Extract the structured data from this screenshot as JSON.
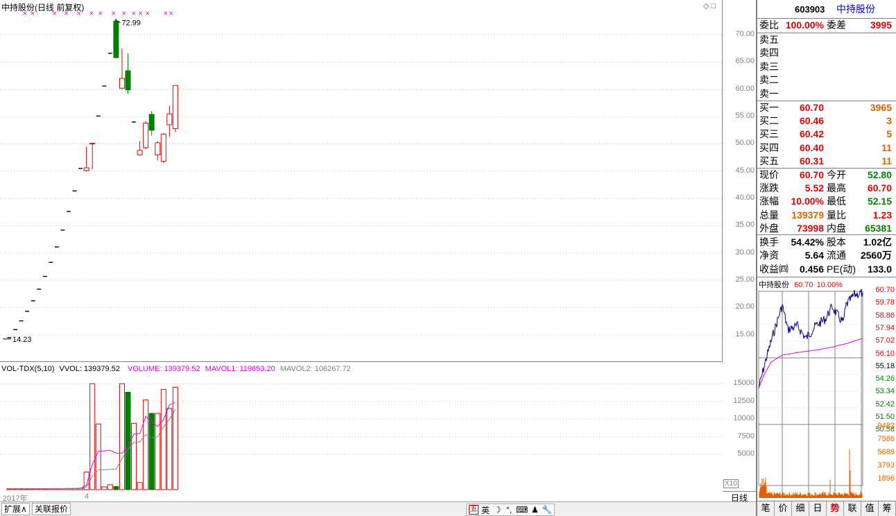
{
  "main": {
    "title": "中持股份(日线 前复权)",
    "max_label": "72.99",
    "min_label": "14.23",
    "price_ticks": [
      "70.00",
      "65.00",
      "60.00",
      "55.00",
      "50.00",
      "45.00",
      "40.00",
      "35.00",
      "30.00",
      "25.00",
      "20.00",
      "15.00"
    ],
    "candles": [
      {
        "o": 14.5,
        "h": 14.5,
        "l": 14.5,
        "c": 14.5
      },
      {
        "o": 15.95,
        "h": 15.95,
        "l": 15.95,
        "c": 15.95
      },
      {
        "o": 17.55,
        "h": 17.55,
        "l": 17.55,
        "c": 17.55
      },
      {
        "o": 19.31,
        "h": 19.31,
        "l": 19.31,
        "c": 19.31
      },
      {
        "o": 21.24,
        "h": 21.24,
        "l": 21.24,
        "c": 21.24
      },
      {
        "o": 23.36,
        "h": 23.36,
        "l": 23.36,
        "c": 23.36
      },
      {
        "o": 25.7,
        "h": 25.7,
        "l": 25.7,
        "c": 25.7
      },
      {
        "o": 28.27,
        "h": 28.27,
        "l": 28.27,
        "c": 28.27
      },
      {
        "o": 31.1,
        "h": 31.1,
        "l": 31.1,
        "c": 31.1
      },
      {
        "o": 34.2,
        "h": 34.2,
        "l": 34.2,
        "c": 34.2
      },
      {
        "o": 37.62,
        "h": 37.62,
        "l": 37.62,
        "c": 37.62
      },
      {
        "o": 41.38,
        "h": 41.38,
        "l": 41.38,
        "c": 41.38
      },
      {
        "o": 45.5,
        "h": 45.5,
        "l": 45.5,
        "c": 45.5
      },
      {
        "o": 45.1,
        "h": 49.5,
        "l": 44.9,
        "c": 45.6
      },
      {
        "o": 50.1,
        "h": 50.1,
        "l": 45.3,
        "c": 50.1
      },
      {
        "o": 55.1,
        "h": 55.1,
        "l": 55.1,
        "c": 55.1
      },
      {
        "o": 60.6,
        "h": 60.6,
        "l": 60.6,
        "c": 60.6
      },
      {
        "o": 66.6,
        "h": 66.6,
        "l": 66.6,
        "c": 66.6
      },
      {
        "o": 72.5,
        "h": 72.99,
        "l": 65.8,
        "c": 65.8
      },
      {
        "o": 60.2,
        "h": 67.5,
        "l": 60.0,
        "c": 62.0
      },
      {
        "o": 63.4,
        "h": 66.6,
        "l": 59.2,
        "c": 59.9
      },
      {
        "o": 54.0,
        "h": 54.0,
        "l": 54.0,
        "c": 54.0
      },
      {
        "o": 48.0,
        "h": 50.5,
        "l": 47.8,
        "c": 48.8
      },
      {
        "o": 49.3,
        "h": 54.2,
        "l": 49.0,
        "c": 53.8
      },
      {
        "o": 55.4,
        "h": 56.0,
        "l": 51.5,
        "c": 52.5
      },
      {
        "o": 48.0,
        "h": 50.5,
        "l": 47.0,
        "c": 50.2
      },
      {
        "o": 46.8,
        "h": 52.0,
        "l": 46.5,
        "c": 51.8
      },
      {
        "o": 53.5,
        "h": 57.0,
        "l": 51.3,
        "c": 55.5
      },
      {
        "o": 52.8,
        "h": 60.7,
        "l": 52.15,
        "c": 60.7
      }
    ],
    "ma_marks_count": 12
  },
  "volume": {
    "label": "VOL-TDX(5,10)",
    "vvol": "VVOL: 139379.52",
    "volume": "VOLUME: 139379.52",
    "mavol1": "MAVOL1: 119653.20",
    "mavol2": "MAVOL2: 106267.72",
    "ticks": [
      "15000",
      "12500",
      "10000",
      "7500",
      "5000"
    ],
    "x10": "X10",
    "bars": [
      120,
      130,
      110,
      140,
      120,
      150,
      130,
      140,
      160,
      150,
      170,
      180,
      200,
      2500,
      15000,
      9300,
      400,
      700,
      450,
      15000,
      13800,
      9400,
      1000,
      12700,
      10800,
      10800,
      14200,
      11500,
      14500
    ]
  },
  "dates": {
    "year": "2017年",
    "month": "4"
  },
  "period": "日线",
  "bottom_tabs": [
    "扩展∧",
    "关联报价"
  ],
  "ime": [
    "五",
    "英",
    "☽",
    "°,",
    "⌨",
    "♟",
    "🔧"
  ],
  "quote": {
    "code": "603903",
    "name": "中持股份",
    "weibi_label": "委比",
    "weibi": "100.00%",
    "weicha_label": "委差",
    "weicha": "3995",
    "asks": [
      {
        "label": "卖五",
        "price": "",
        "vol": ""
      },
      {
        "label": "卖四",
        "price": "",
        "vol": ""
      },
      {
        "label": "卖三",
        "price": "",
        "vol": ""
      },
      {
        "label": "卖二",
        "price": "",
        "vol": ""
      },
      {
        "label": "卖一",
        "price": "",
        "vol": ""
      }
    ],
    "bids": [
      {
        "label": "买一",
        "price": "60.70",
        "vol": "3965"
      },
      {
        "label": "买二",
        "price": "60.46",
        "vol": "3"
      },
      {
        "label": "买三",
        "price": "60.42",
        "vol": "5"
      },
      {
        "label": "买四",
        "price": "60.40",
        "vol": "11"
      },
      {
        "label": "买五",
        "price": "60.31",
        "vol": "11"
      }
    ],
    "stats": [
      {
        "l1": "现价",
        "v1": "60.70",
        "c1": "red",
        "l2": "今开",
        "v2": "52.80",
        "c2": "green"
      },
      {
        "l1": "涨跌",
        "v1": "5.52",
        "c1": "red",
        "l2": "最高",
        "v2": "60.70",
        "c2": "red"
      },
      {
        "l1": "涨幅",
        "v1": "10.00%",
        "c1": "red",
        "l2": "最低",
        "v2": "52.15",
        "c2": "green"
      },
      {
        "l1": "总量",
        "v1": "139379",
        "c1": "orange",
        "l2": "量比",
        "v2": "1.23",
        "c2": "red"
      },
      {
        "l1": "外盘",
        "v1": "73998",
        "c1": "red",
        "l2": "内盘",
        "v2": "65381",
        "c2": "green"
      }
    ],
    "info": [
      {
        "l1": "换手",
        "v1": "54.42%",
        "l2": "股本",
        "v2": "1.02亿"
      },
      {
        "l1": "净资",
        "v1": "5.64",
        "l2": "流通",
        "v2": "2560万"
      },
      {
        "l1": "收益㈣",
        "v1": "0.456",
        "l2": "PE(动)",
        "v2": "133.0"
      }
    ]
  },
  "mini": {
    "title_name": "中持股份",
    "title_price": "60.70",
    "title_pct": "10.00%",
    "price_ticks": [
      "60.70",
      "59.78",
      "58.86",
      "57.94",
      "57.02",
      "56.10",
      "55.18",
      "54.26",
      "53.34",
      "52.42",
      "51.50",
      "50.58"
    ],
    "vol_ticks": [
      "9482",
      "7586",
      "5689",
      "3793",
      "1896"
    ]
  },
  "rp_tabs": [
    "笔",
    "价",
    "细",
    "日",
    "势",
    "联",
    "值",
    "筹"
  ],
  "colors": {
    "up": "#e00000",
    "down": "#008000",
    "ma1": "#e000e0",
    "ma2": "#808080",
    "line": "#000080"
  }
}
